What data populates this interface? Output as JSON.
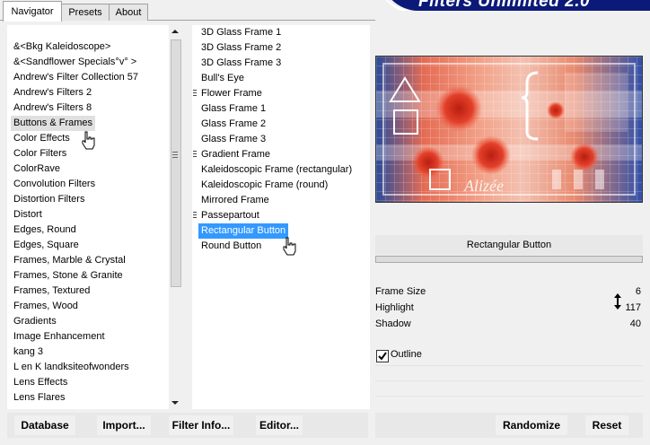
{
  "tabs": [
    {
      "label": "Navigator"
    },
    {
      "label": "Presets"
    },
    {
      "label": "About"
    }
  ],
  "banner": {
    "title": "Filters Unlimited 2.0"
  },
  "categories": [
    {
      "label": "&<Bkg Kaleidoscope>"
    },
    {
      "label": "&<Sandflower Specials°v° >"
    },
    {
      "label": "Andrew's Filter Collection 57"
    },
    {
      "label": "Andrew's Filters 2"
    },
    {
      "label": "Andrew's Filters 8"
    },
    {
      "label": "Buttons & Frames"
    },
    {
      "label": "Color Effects"
    },
    {
      "label": "Color Filters"
    },
    {
      "label": "ColorRave"
    },
    {
      "label": "Convolution Filters"
    },
    {
      "label": "Distortion Filters"
    },
    {
      "label": "Distort"
    },
    {
      "label": "Edges, Round"
    },
    {
      "label": "Edges, Square"
    },
    {
      "label": "Frames, Marble & Crystal"
    },
    {
      "label": "Frames, Stone & Granite"
    },
    {
      "label": "Frames, Textured"
    },
    {
      "label": "Frames, Wood"
    },
    {
      "label": "Gradients"
    },
    {
      "label": "Image Enhancement"
    },
    {
      "label": "kang 3"
    },
    {
      "label": "L en K landksiteofwonders"
    },
    {
      "label": "Lens Effects"
    },
    {
      "label": "Lens Flares"
    }
  ],
  "filters": [
    {
      "label": "3D Glass Frame 1",
      "marker": false
    },
    {
      "label": "3D Glass Frame 2",
      "marker": false
    },
    {
      "label": "3D Glass Frame 3",
      "marker": false
    },
    {
      "label": "Bull's Eye",
      "marker": false
    },
    {
      "label": "Flower Frame",
      "marker": true
    },
    {
      "label": "Glass Frame 1",
      "marker": false
    },
    {
      "label": "Glass Frame 2",
      "marker": false
    },
    {
      "label": "Glass Frame 3",
      "marker": false
    },
    {
      "label": "Gradient Frame",
      "marker": true
    },
    {
      "label": "Kaleidoscopic Frame (rectangular)",
      "marker": false
    },
    {
      "label": "Kaleidoscopic Frame (round)",
      "marker": false
    },
    {
      "label": "Mirrored Frame",
      "marker": false
    },
    {
      "label": "Passepartout",
      "marker": true
    },
    {
      "label": "Rectangular Button",
      "marker": false
    },
    {
      "label": "Round Button",
      "marker": false
    }
  ],
  "selected_filter_title": "Rectangular Button",
  "preview": {
    "watermark": "Alizée"
  },
  "params": [
    {
      "label": "Frame Size",
      "value": "6"
    },
    {
      "label": "Highlight",
      "value": "117"
    },
    {
      "label": "Shadow",
      "value": "40"
    }
  ],
  "outline": {
    "label": "Outline",
    "checked": true
  },
  "bottom_left": {
    "database": "Database",
    "import": "Import...",
    "filter_info": "Filter Info...",
    "editor": "Editor..."
  },
  "bottom_right": {
    "randomize": "Randomize",
    "reset": "Reset"
  },
  "colors": {
    "selection": "#3399ff",
    "banner": "#0b1a78"
  }
}
